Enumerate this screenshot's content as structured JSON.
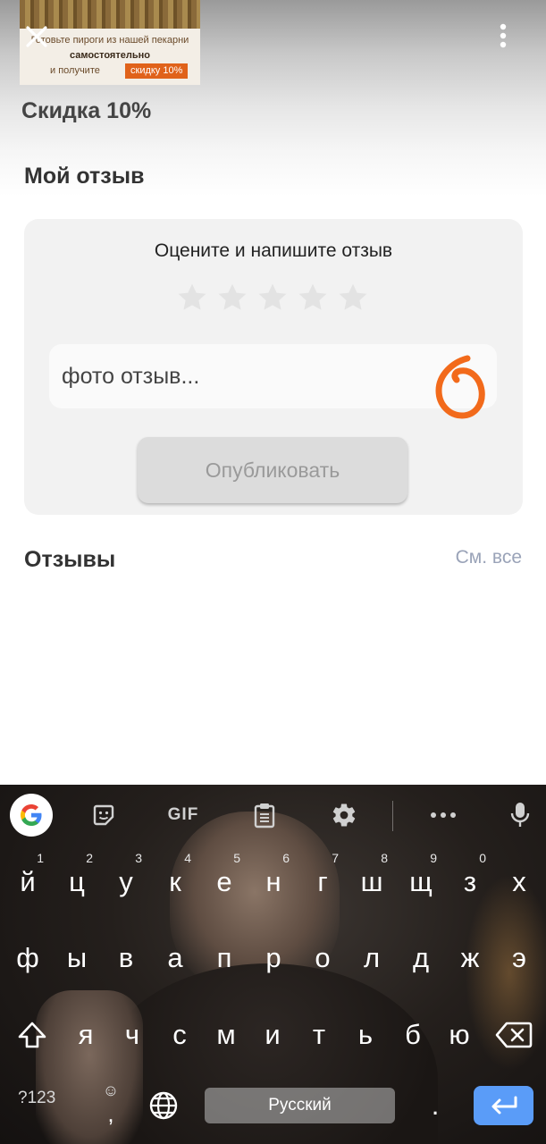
{
  "header": {
    "promo": {
      "line1": "Готовьте пироги из нашей пекарни",
      "line2": "самостоятельно",
      "line3": "и получите",
      "tag": "скидку 10%"
    },
    "close_icon": "close-icon",
    "more_icon": "more-vert-icon",
    "title": "Скидка 10%"
  },
  "my_review": {
    "title": "Мой отзыв",
    "prompt": "Оцените и напишите отзыв",
    "rating": 0,
    "max_rating": 5,
    "input_value": "фото отзыв...",
    "publish_label": "Опубликовать",
    "annotation_color": "#f26a1b"
  },
  "reviews": {
    "title": "Отзывы",
    "see_all": "См. все"
  },
  "keyboard": {
    "toolbar": [
      "google-icon",
      "sticker-icon",
      "GIF",
      "clipboard-icon",
      "settings-icon",
      "more-horiz-icon",
      "mic-icon"
    ],
    "row1": [
      {
        "key": "й",
        "hint": "1"
      },
      {
        "key": "ц",
        "hint": "2"
      },
      {
        "key": "у",
        "hint": "3"
      },
      {
        "key": "к",
        "hint": "4"
      },
      {
        "key": "е",
        "hint": "5"
      },
      {
        "key": "н",
        "hint": "6"
      },
      {
        "key": "г",
        "hint": "7"
      },
      {
        "key": "ш",
        "hint": "8"
      },
      {
        "key": "щ",
        "hint": "9"
      },
      {
        "key": "з",
        "hint": "0"
      },
      {
        "key": "х",
        "hint": ""
      }
    ],
    "row2": [
      "ф",
      "ы",
      "в",
      "а",
      "п",
      "р",
      "о",
      "л",
      "д",
      "ж",
      "э"
    ],
    "row3": [
      "я",
      "ч",
      "с",
      "м",
      "и",
      "т",
      "ь",
      "б",
      "ю"
    ],
    "symbols_label": "?123",
    "comma": ",",
    "space_label": "Русский",
    "period": ".",
    "accent_color": "#5a9cf8"
  }
}
